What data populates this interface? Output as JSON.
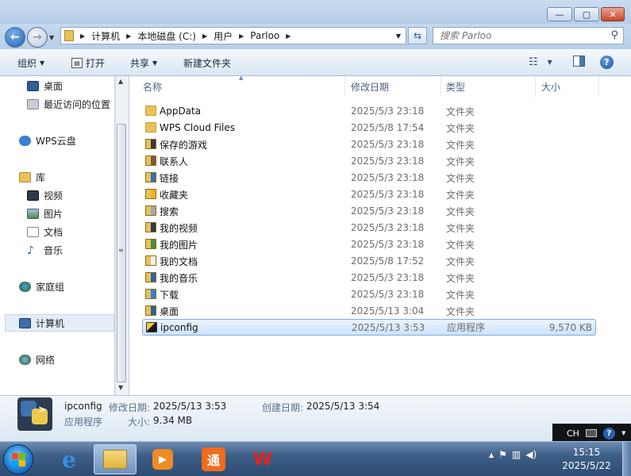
{
  "window": {
    "minimize": "—",
    "maximize": "▢",
    "close": "✕"
  },
  "address": {
    "crumbs": [
      "计算机",
      "本地磁盘 (C:)",
      "用户",
      "Parloo"
    ],
    "search_placeholder": "搜索 Parloo"
  },
  "toolbar": {
    "organize": "组织",
    "open": "打开",
    "share": "共享",
    "new_folder": "新建文件夹"
  },
  "nav": {
    "desktop": "桌面",
    "recent": "最近访问的位置",
    "wps_cloud": "WPS云盘",
    "libraries": "库",
    "videos": "视频",
    "pictures": "图片",
    "documents": "文档",
    "music": "音乐",
    "homegroup": "家庭组",
    "computer": "计算机",
    "network": "网络"
  },
  "columns": {
    "name": "名称",
    "date": "修改日期",
    "type": "类型",
    "size": "大小"
  },
  "files": [
    {
      "name": "AppData",
      "date": "2025/5/3 23:18",
      "type": "文件夹",
      "size": ""
    },
    {
      "name": "WPS Cloud Files",
      "date": "2025/5/8 17:54",
      "type": "文件夹",
      "size": ""
    },
    {
      "name": "保存的游戏",
      "date": "2025/5/3 23:18",
      "type": "文件夹",
      "size": ""
    },
    {
      "name": "联系人",
      "date": "2025/5/3 23:18",
      "type": "文件夹",
      "size": ""
    },
    {
      "name": "链接",
      "date": "2025/5/3 23:18",
      "type": "文件夹",
      "size": ""
    },
    {
      "name": "收藏夹",
      "date": "2025/5/3 23:18",
      "type": "文件夹",
      "size": ""
    },
    {
      "name": "搜索",
      "date": "2025/5/3 23:18",
      "type": "文件夹",
      "size": ""
    },
    {
      "name": "我的视频",
      "date": "2025/5/3 23:18",
      "type": "文件夹",
      "size": ""
    },
    {
      "name": "我的图片",
      "date": "2025/5/3 23:18",
      "type": "文件夹",
      "size": ""
    },
    {
      "name": "我的文档",
      "date": "2025/5/8 17:52",
      "type": "文件夹",
      "size": ""
    },
    {
      "name": "我的音乐",
      "date": "2025/5/3 23:18",
      "type": "文件夹",
      "size": ""
    },
    {
      "name": "下载",
      "date": "2025/5/3 23:18",
      "type": "文件夹",
      "size": ""
    },
    {
      "name": "桌面",
      "date": "2025/5/13 3:04",
      "type": "文件夹",
      "size": ""
    },
    {
      "name": "ipconfig",
      "date": "2025/5/13 3:53",
      "type": "应用程序",
      "size": "9,570 KB"
    }
  ],
  "details": {
    "name": "ipconfig",
    "type": "应用程序",
    "modified_label": "修改日期:",
    "modified": "2025/5/13 3:53",
    "created_label": "创建日期:",
    "created": "2025/5/13 3:54",
    "size_label": "大小:",
    "size": "9.34 MB"
  },
  "ime": {
    "lang": "CH"
  },
  "clock": {
    "time": "15:15",
    "date": "2025/5/22"
  },
  "colors": {
    "selection": "#cde3fa",
    "taskbar": "#3d5e86",
    "folder": "#e8c15a"
  }
}
